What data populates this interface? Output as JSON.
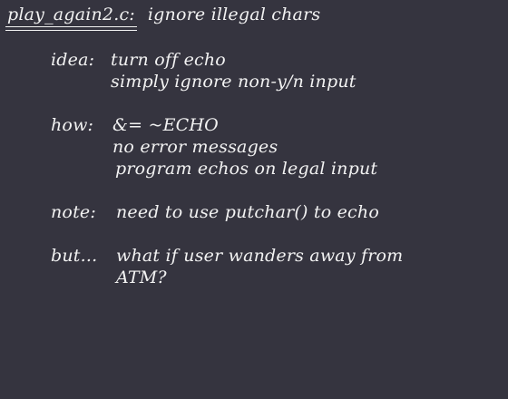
{
  "title": {
    "file": "play_again2.c:",
    "subtitle": "ignore illegal chars"
  },
  "sections": [
    {
      "label": "idea:",
      "lines": [
        "turn off echo",
        "simply ignore non-y/n input"
      ]
    },
    {
      "label": "how:",
      "lines": [
        "&= ~ECHO",
        "no error messages",
        "program echos on legal input"
      ]
    },
    {
      "label": "note:",
      "lines": [
        "need to use putchar() to echo"
      ]
    },
    {
      "label": "but...",
      "lines": [
        "what if user wanders away from",
        "ATM?"
      ]
    }
  ]
}
